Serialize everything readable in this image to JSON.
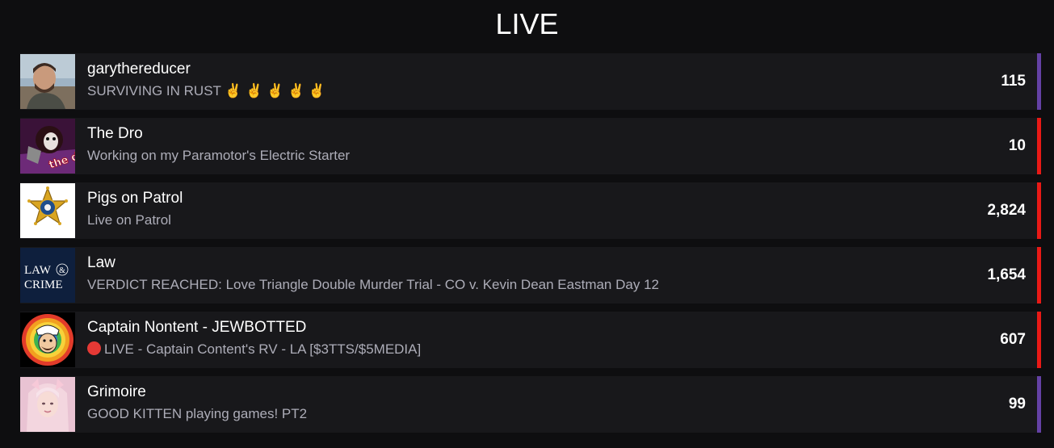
{
  "page": {
    "title": "LIVE"
  },
  "streams": [
    {
      "name": "garythereducer",
      "status": "SURVIVING IN RUST ✌️ ✌️ ✌️ ✌️ ✌️",
      "viewers": "115",
      "accent": "#6441a5",
      "avatar_icon": "man-selfie-avatar"
    },
    {
      "name": "The Dro",
      "status": "Working on my Paramotor's Electric Starter",
      "viewers": "10",
      "accent": "#e91916",
      "avatar_icon": "the-dro-logo"
    },
    {
      "name": "Pigs on Patrol",
      "status": "Live on Patrol",
      "viewers": "2,824",
      "accent": "#e91916",
      "avatar_icon": "sheriff-star-badge"
    },
    {
      "name": "Law",
      "status": "VERDICT REACHED: Love Triangle Double Murder Trial - CO v. Kevin Dean Eastman Day 12",
      "viewers": "1,654",
      "accent": "#e91916",
      "avatar_icon": "law-and-crime-logo",
      "avatar_text": {
        "line1": "LAW",
        "amp": "&",
        "line2": "CRIME"
      }
    },
    {
      "name": "Captain Nontent - JEWBOTTED",
      "status": "LIVE - Captain Content's RV - LA [$3TTS/$5MEDIA]",
      "viewers": "607",
      "accent": "#e91916",
      "avatar_icon": "captain-content-logo"
    },
    {
      "name": "Grimoire",
      "status": "GOOD KITTEN playing games! PT2",
      "viewers": "99",
      "accent": "#6441a5",
      "avatar_icon": "girl-pink-hair-avatar"
    }
  ]
}
